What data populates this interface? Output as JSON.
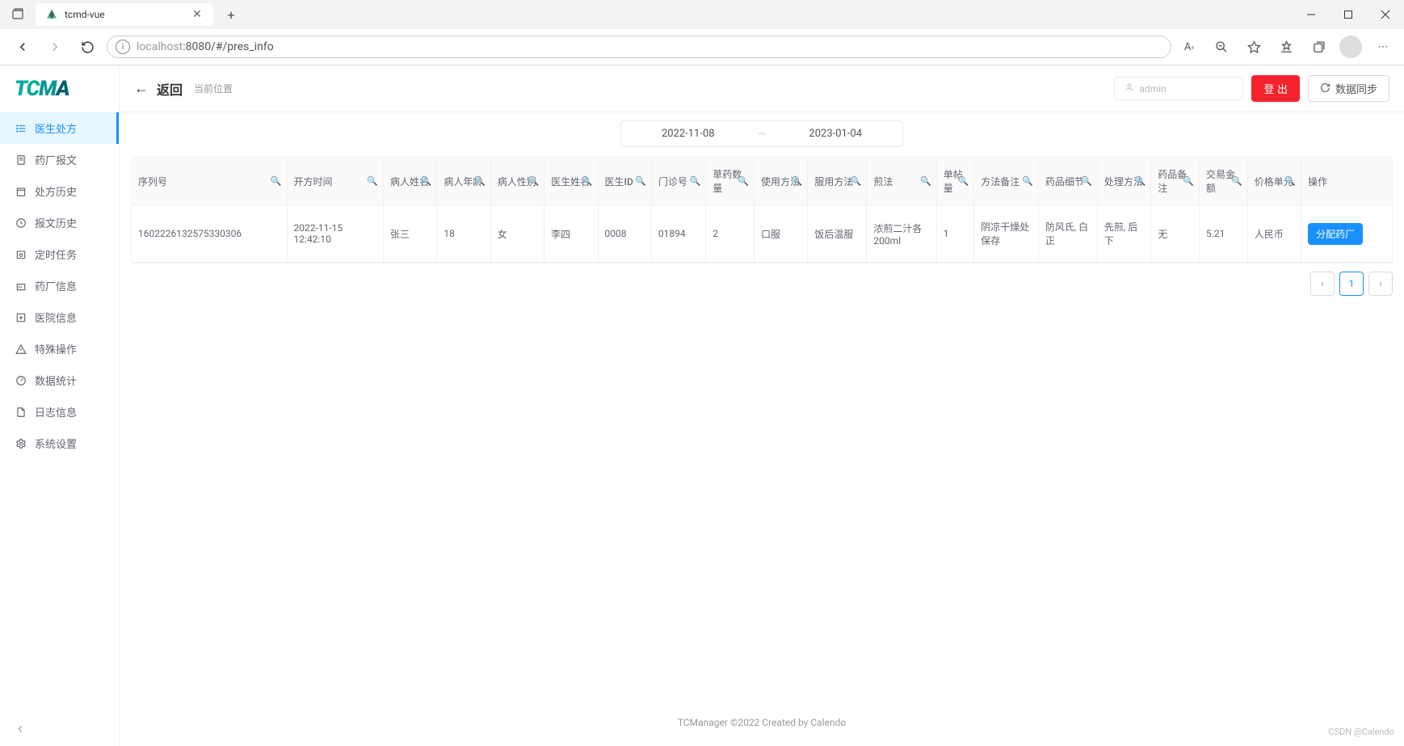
{
  "browser": {
    "tab_title": "tcmd-vue",
    "url_host": "localhost",
    "url_port_path": ":8080/#/pres_info"
  },
  "logo": {
    "t": "T",
    "c": "C",
    "m": "M",
    "a": "A"
  },
  "sidebar": {
    "items": [
      {
        "label": "医生处方"
      },
      {
        "label": "药厂报文"
      },
      {
        "label": "处方历史"
      },
      {
        "label": "报文历史"
      },
      {
        "label": "定时任务"
      },
      {
        "label": "药厂信息"
      },
      {
        "label": "医院信息"
      },
      {
        "label": "特殊操作"
      },
      {
        "label": "数据统计"
      },
      {
        "label": "日志信息"
      },
      {
        "label": "系统设置"
      }
    ]
  },
  "header": {
    "back_label": "返回",
    "breadcrumb": "当前位置",
    "user_placeholder": "admin",
    "logout_label": "登 出",
    "sync_label": "数据同步"
  },
  "date_range": {
    "start": "2022-11-08",
    "end": "2023-01-04",
    "separator": "~"
  },
  "table": {
    "columns": [
      "序列号",
      "开方时间",
      "病人姓名",
      "病人年龄",
      "病人性别",
      "医生姓名",
      "医生ID",
      "门诊号",
      "草药数量",
      "使用方法",
      "服用方法",
      "煎法",
      "单帖量",
      "方法备注",
      "药品细节",
      "处理方法",
      "药品备注",
      "交易金额",
      "价格单元",
      "操作"
    ],
    "rows": [
      {
        "serial": "1602226132575330306",
        "open_time": "2022-11-15 12:42:10",
        "patient_name": "张三",
        "patient_age": "18",
        "patient_gender": "女",
        "doctor_name": "李四",
        "doctor_id": "0008",
        "outpatient_no": "01894",
        "herb_qty": "2",
        "usage": "口服",
        "take_method": "饭后温服",
        "decoct": "浓煎二汁各200ml",
        "dose_qty": "1",
        "method_remark": "阴凉干燥处保存",
        "drug_detail": "防风氏, 白正",
        "process": "先煎, 后下",
        "drug_remark": "无",
        "amount": "5.21",
        "currency": "人民币"
      }
    ],
    "action_label": "分配药厂"
  },
  "pagination": {
    "current": "1"
  },
  "footer": {
    "text": "TCManager ©2022 Created by Calendo"
  },
  "watermark": "CSDN @Calendo"
}
